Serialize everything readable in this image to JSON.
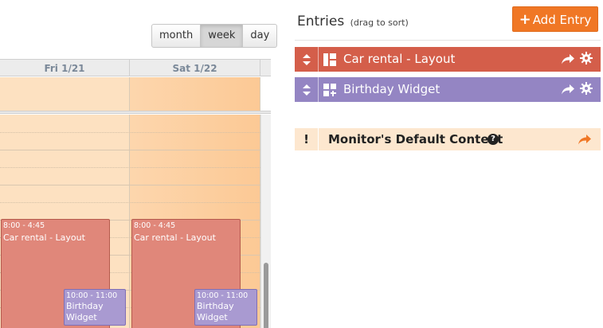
{
  "views": {
    "month": "month",
    "week": "week",
    "day": "day"
  },
  "calendar": {
    "days": [
      "Fri 1/21",
      "Sat 1/22"
    ],
    "events": [
      {
        "time": "8:00 - 4:45",
        "title": "Car rental - Layout"
      },
      {
        "time": "8:00 - 4:45",
        "title": "Car rental - Layout"
      },
      {
        "time": "10:00 - 11:00",
        "title": "Birthday Widget"
      },
      {
        "time": "10:00 - 11:00",
        "title": "Birthday Widget"
      }
    ]
  },
  "entries": {
    "title": "Entries",
    "hint": "(drag to sort)",
    "add_label": "Add Entry",
    "items": [
      {
        "label": "Car rental - Layout",
        "color": "#d45e4a"
      },
      {
        "label": "Birthday Widget",
        "color": "#9485c3"
      }
    ],
    "default": {
      "label": "Monitor's Default Content",
      "help": "?",
      "bang": "!"
    }
  },
  "colors": {
    "accent": "#f07725",
    "default_share": "#f07725"
  }
}
